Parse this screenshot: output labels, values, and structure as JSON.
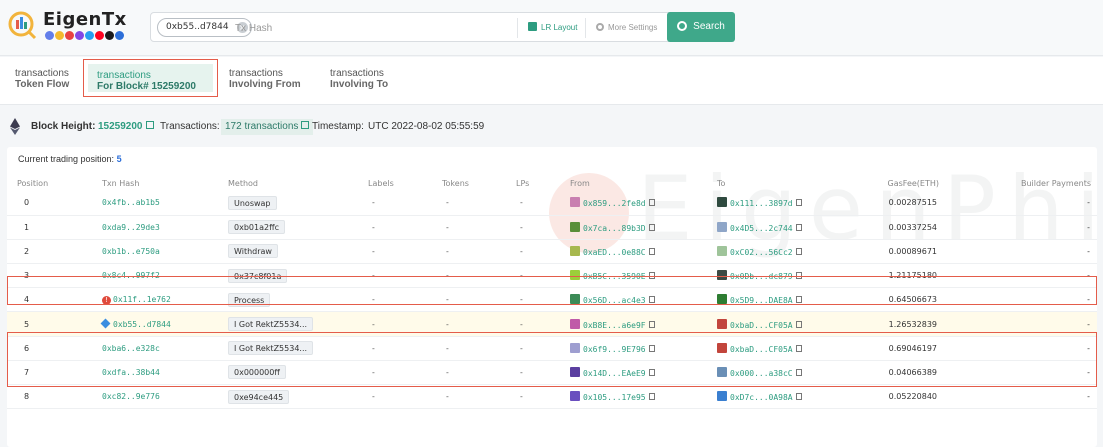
{
  "header": {
    "logo_text": "EigenTx",
    "chain_icon_colors": [
      "#627eea",
      "#f3ba2f",
      "#e84142",
      "#8247e5",
      "#28a0f0",
      "#ff0420",
      "#1b1b1b",
      "#2d6fd9"
    ],
    "hash_chip": "0xb55..d7844",
    "search_placeholder": "Tx Hash",
    "lr_layout": "LR Layout",
    "more_settings": "More Settings",
    "search_button": "Search"
  },
  "tabs": [
    {
      "line1": "transactions",
      "line2": "Token Flow"
    },
    {
      "line1": "transactions",
      "line2": "For Block# 15259200"
    },
    {
      "line1": "transactions",
      "line2": "Involving From"
    },
    {
      "line1": "transactions",
      "line2": "Involving To"
    }
  ],
  "block": {
    "height_label": "Block Height:",
    "height_value": "15259200",
    "tx_label": "Transactions:",
    "tx_count": "172 transactions",
    "timestamp_label": "Timestamp:",
    "timestamp_value": "UTC 2022-08-02 05:55:59"
  },
  "panel": {
    "current_label": "Current trading position:",
    "current_value": "5",
    "watermark": "EigenPhi"
  },
  "columns": [
    "Position",
    "Txn Hash",
    "Method",
    "Labels",
    "Tokens",
    "LPs",
    "From",
    "To",
    "GasFee(ETH)",
    "Builder Payments"
  ],
  "rows": [
    {
      "pos": "0",
      "hash": "0x4fb..ab1b5",
      "method": "Unoswap",
      "labels": "-",
      "tokens": "-",
      "lps": "-",
      "from": "0x859...2fe8d",
      "to": "0x111...3897d",
      "gas": "0.00287515",
      "builder": "-",
      "from_color": "#c97fb0",
      "to_color": "#2f4a3f"
    },
    {
      "pos": "1",
      "hash": "0xda9..29de3",
      "method": "0xb01a2ffc",
      "labels": "-",
      "tokens": "-",
      "lps": "-",
      "from": "0x7ca...89b3D",
      "to": "0x4D5...2c744",
      "gas": "0.00337254",
      "builder": "-",
      "from_color": "#5a8f3a",
      "to_color": "#8fa6c8"
    },
    {
      "pos": "2",
      "hash": "0xb1b..e750a",
      "method": "Withdraw",
      "labels": "-",
      "tokens": "-",
      "lps": "-",
      "from": "0xaED...0e88C",
      "to": "0xC02...56Cc2",
      "gas": "0.00089671",
      "builder": "-",
      "from_color": "#a7b84e",
      "to_color": "#9fc49a"
    },
    {
      "pos": "3",
      "hash": "0x8c4..997f2",
      "method": "0x37c8f01a",
      "labels": "-",
      "tokens": "-",
      "lps": "-",
      "from": "0xB5C...3590E",
      "to": "0x0Db...dc879",
      "gas": "1.21175180",
      "builder": "-",
      "from_color": "#9bcf3a",
      "to_color": "#3d4a44"
    },
    {
      "pos": "4",
      "hash": "0x11f..1e762",
      "method": "Process",
      "labels": "-",
      "tokens": "-",
      "lps": "-",
      "from": "0x56D...ac4e3",
      "to": "0x5D9...DAE8A",
      "gas": "0.64506673",
      "builder": "-",
      "from_color": "#3c8b57",
      "to_color": "#2e7d32",
      "warn": true
    },
    {
      "pos": "5",
      "hash": "0xb55..d7844",
      "method": "I Got RektZ5534...",
      "labels": "-",
      "tokens": "-",
      "lps": "-",
      "from": "0xB8E...a6e9F",
      "to": "0xbaD...CF05A",
      "gas": "1.26532839",
      "builder": "-",
      "from_color": "#c05aa8",
      "to_color": "#c2453c",
      "current": true
    },
    {
      "pos": "6",
      "hash": "0xba6..e328c",
      "method": "I Got RektZ5534...",
      "labels": "-",
      "tokens": "-",
      "lps": "-",
      "from": "0x6f9...9E796",
      "to": "0xbaD...CF05A",
      "gas": "0.69046197",
      "builder": "-",
      "from_color": "#9e9ed0",
      "to_color": "#c2453c"
    },
    {
      "pos": "7",
      "hash": "0xdfa..38b44",
      "method": "0x000000ff",
      "labels": "-",
      "tokens": "-",
      "lps": "-",
      "from": "0x14D...EAeE9",
      "to": "0x000...a38cC",
      "gas": "0.04066389",
      "builder": "-",
      "from_color": "#5b3fa0",
      "to_color": "#6a8fb6"
    },
    {
      "pos": "8",
      "hash": "0xc82..9e776",
      "method": "0xe94ce445",
      "labels": "-",
      "tokens": "-",
      "lps": "-",
      "from": "0x105...17e95",
      "to": "0xD7c...0A98A",
      "gas": "0.05220840",
      "builder": "-",
      "from_color": "#6a4fbf",
      "to_color": "#3a7fd0"
    }
  ]
}
